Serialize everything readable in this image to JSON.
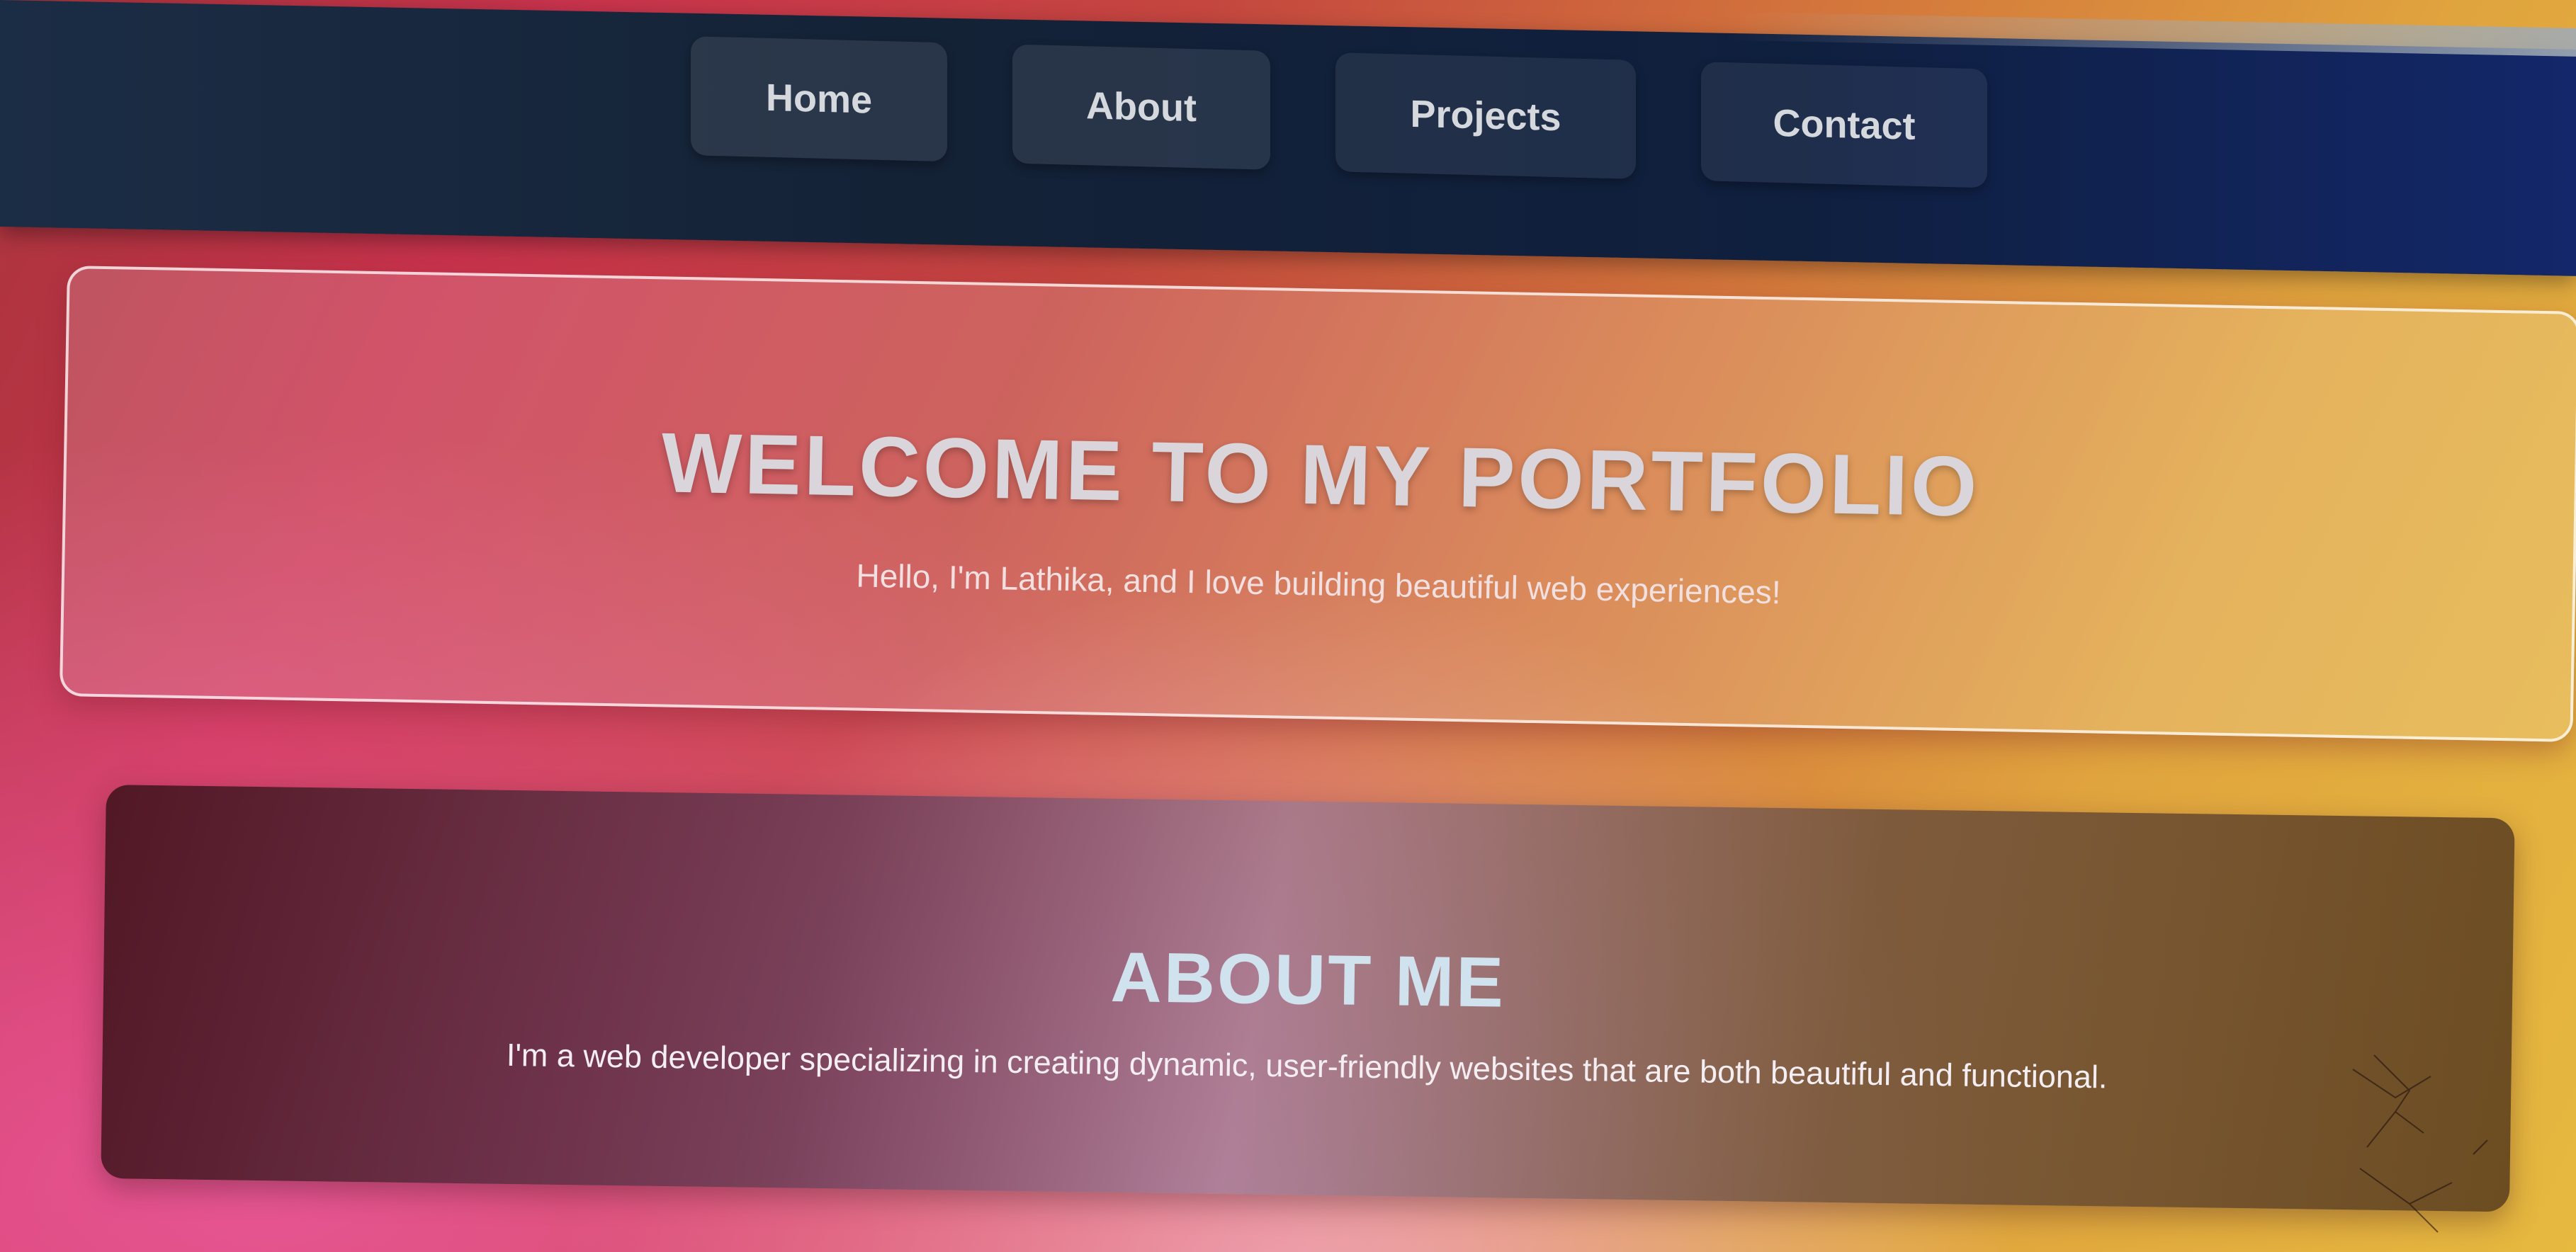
{
  "nav": {
    "items": [
      {
        "label": "Home"
      },
      {
        "label": "About"
      },
      {
        "label": "Projects"
      },
      {
        "label": "Contact"
      }
    ]
  },
  "hero": {
    "title": "WELCOME TO MY PORTFOLIO",
    "subtitle": "Hello, I'm Lathika, and I love building beautiful web experiences!"
  },
  "about": {
    "title": "ABOUT ME",
    "text": "I'm a web developer specializing in creating dynamic, user-friendly websites that are both beautiful and functional."
  },
  "colors": {
    "navbar": "#142236",
    "gradient_start": "#c9334d",
    "gradient_end": "#e6b93f",
    "about_card": "#5a2a35"
  }
}
